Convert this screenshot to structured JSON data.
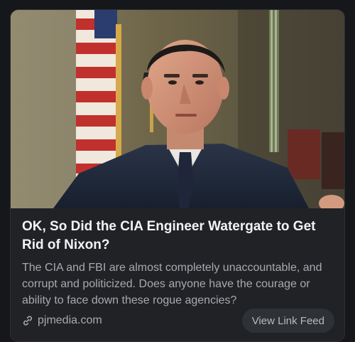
{
  "card": {
    "image_alt": "Portrait photo of a man in a dark suit seated in front of an American flag",
    "headline": "OK, So Did the CIA Engineer Watergate to Get Rid of Nixon?",
    "summary": "The CIA and FBI are almost completely unaccountable, and corrupt and politicized. Does anyone have the courage or ability to face down these rogue agencies?",
    "domain": "pjmedia.com",
    "domain_icon": "link-icon",
    "view_button_label": "View Link Feed"
  },
  "colors": {
    "page_background": "#15171a",
    "card_background": "#202225",
    "headline_text": "#f2f3f5",
    "secondary_text": "#a7aab0",
    "button_background": "#2e3135"
  }
}
